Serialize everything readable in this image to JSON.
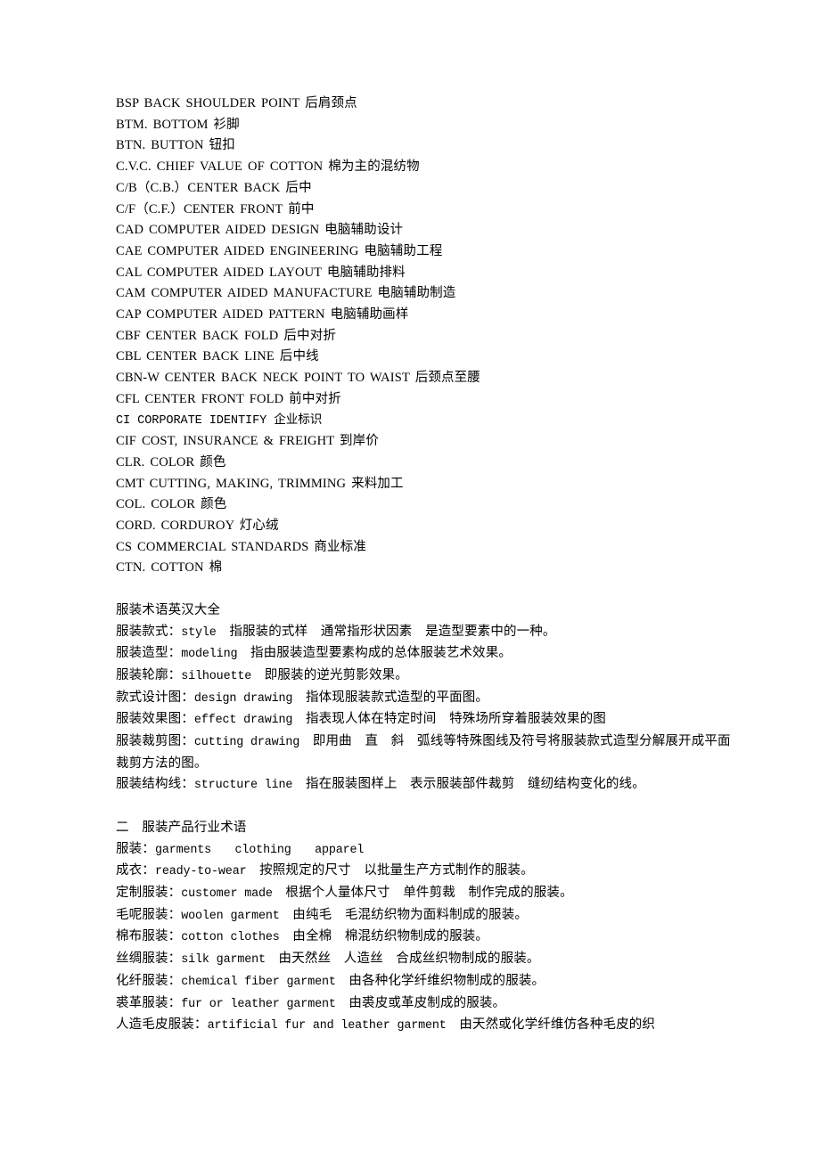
{
  "document": {
    "title": "服装术语英汉大全",
    "background_color": "#ffffff",
    "text_color": "#000000"
  },
  "sections": [
    {
      "id": "abbreviations",
      "style": "abbrev",
      "lines": [
        "BSP BACK SHOULDER POINT 后肩颈点",
        "BTM. BOTTOM 衫脚",
        "BTN. BUTTON 钮扣",
        "C.V.C. CHIEF VALUE OF COTTON 棉为主的混纺物",
        "C/B（C.B.）CENTER BACK 后中",
        "C/F（C.F.）CENTER FRONT 前中",
        "CAD COMPUTER AIDED DESIGN 电脑辅助设计",
        "CAE COMPUTER AIDED ENGINEERING 电脑辅助工程",
        "CAL COMPUTER AIDED LAYOUT 电脑辅助排料",
        "CAM COMPUTER AIDED MANUFACTURE 电脑辅助制造",
        "CAP COMPUTER AIDED PATTERN 电脑辅助画样",
        "CBF CENTER BACK FOLD 后中对折",
        "CBL CENTER BACK LINE 后中线",
        "CBN-W CENTER BACK NECK POINT TO WAIST 后颈点至腰",
        "CFL CENTER FRONT FOLD 前中对折",
        "CI CORPORATE IDENTIFY 企业标识",
        "CIF COST, INSURANCE & FREIGHT 到岸价",
        "CLR. COLOR 颜色",
        "CMT CUTTING, MAKING, TRIMMING 来料加工",
        "COL. COLOR 颜色",
        "CORD. CORDUROY 灯心绒",
        "CS COMMERCIAL STANDARDS 商业标准",
        "CTN. COTTON 棉"
      ],
      "mono_line_indexes": [
        15
      ]
    },
    {
      "id": "design-terms",
      "heading": "服装术语英汉大全",
      "entries": [
        {
          "cn": "服装款式：",
          "en": "style",
          "desc": "　指服装的式样　通常指形状因素　是造型要素中的一种。"
        },
        {
          "cn": "服装造型：",
          "en": "modeling",
          "desc": "　指由服装造型要素构成的总体服装艺术效果。"
        },
        {
          "cn": "服装轮廓：",
          "en": "silhouette",
          "desc": "　即服装的逆光剪影效果。"
        },
        {
          "cn": "款式设计图：",
          "en": "design drawing",
          "desc": "　指体现服装款式造型的平面图。"
        },
        {
          "cn": "服装效果图：",
          "en": "effect drawing",
          "desc": "　指表现人体在特定时间　特殊场所穿着服装效果的图"
        },
        {
          "cn": "服装裁剪图：",
          "en": "cutting drawing",
          "desc": "　即用曲　直　斜　弧线等特殊图线及符号将服装款式造型分解展开成平面裁剪方法的图。"
        },
        {
          "cn": "服装结构线：",
          "en": "structure line",
          "desc": "　指在服装图样上　表示服装部件裁剪　缝纫结构变化的线。"
        }
      ]
    },
    {
      "id": "industry-terms",
      "heading": "二　服装产品行业术语",
      "entries": [
        {
          "cn": "服装：",
          "en": "garments　　clothing　　apparel",
          "desc": ""
        },
        {
          "cn": "成衣：",
          "en": "ready-to-wear",
          "desc": "　按照规定的尺寸　以批量生产方式制作的服装。"
        },
        {
          "cn": "定制服装：",
          "en": "customer made",
          "desc": "　根据个人量体尺寸　单件剪裁　制作完成的服装。"
        },
        {
          "cn": "毛呢服装：",
          "en": "woolen garment",
          "desc": "　由纯毛　毛混纺织物为面料制成的服装。"
        },
        {
          "cn": "棉布服装：",
          "en": "cotton clothes",
          "desc": "　由全棉　棉混纺织物制成的服装。"
        },
        {
          "cn": "丝绸服装：",
          "en": "silk garment",
          "desc": "　由天然丝　人造丝　合成丝织物制成的服装。"
        },
        {
          "cn": "化纤服装：",
          "en": "chemical fiber garment",
          "desc": "　由各种化学纤维织物制成的服装。"
        },
        {
          "cn": "裘革服装：",
          "en": "fur or leather garment",
          "desc": "　由裘皮或革皮制成的服装。"
        },
        {
          "cn": "人造毛皮服装：",
          "en": "artificial fur and leather garment",
          "desc": "　由天然或化学纤维仿各种毛皮的织"
        }
      ]
    }
  ]
}
